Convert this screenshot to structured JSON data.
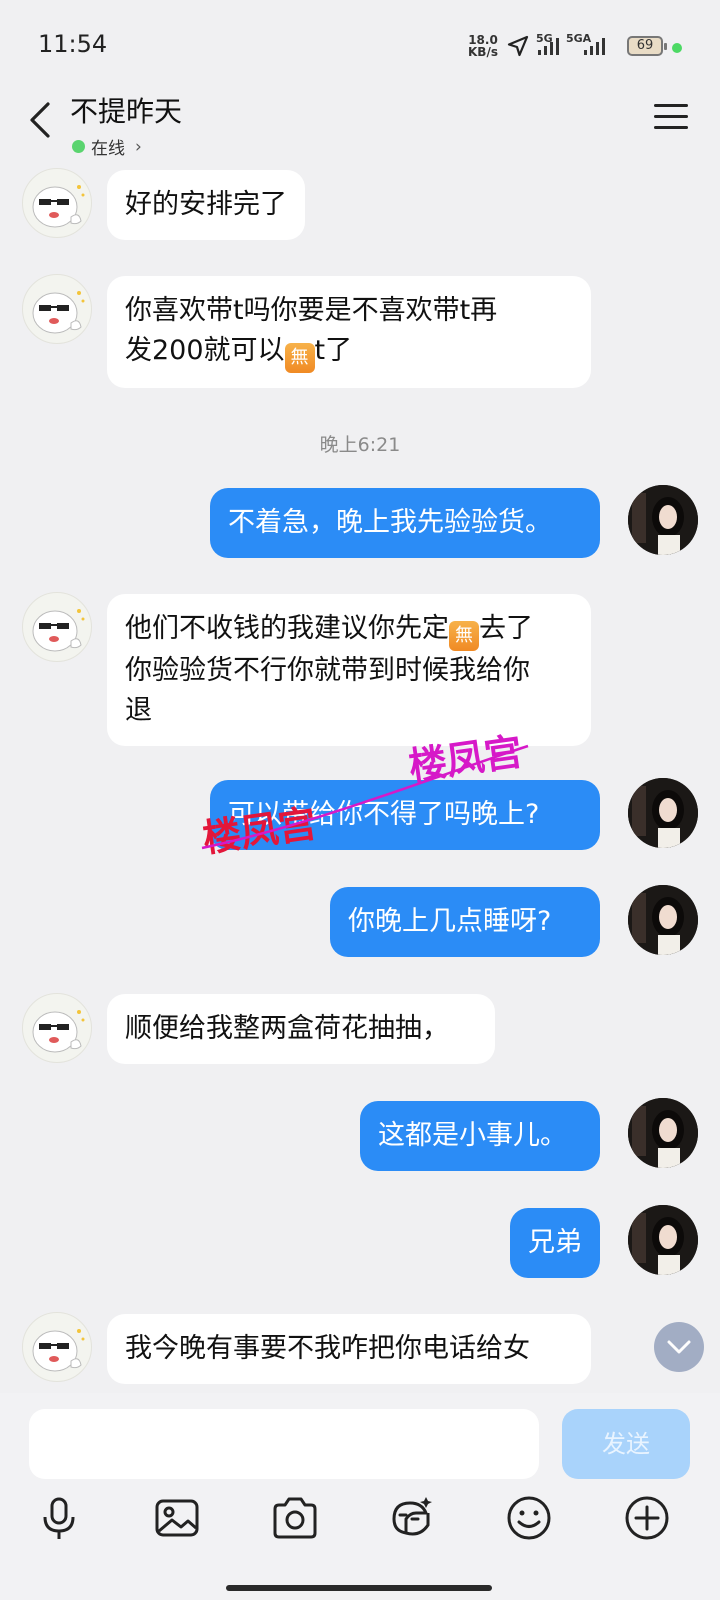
{
  "status_bar": {
    "time": "11:54",
    "net_speed_value": "18.0",
    "net_speed_unit": "KB/s",
    "sim1": "5G",
    "sim2": "5GA",
    "battery": "69"
  },
  "header": {
    "title": "不提昨天",
    "status": "在线",
    "status_chevron": "›"
  },
  "messages": [
    {
      "from": "other",
      "text": "好的安排完了"
    },
    {
      "from": "other",
      "text_part1": "你喜欢带t吗你要是不喜欢带t再\n发200就可以",
      "emoji": "無",
      "text_part2": "t了"
    },
    {
      "from": "time",
      "text": "晚上6:21"
    },
    {
      "from": "me",
      "text": "不着急，晚上我先验验货。"
    },
    {
      "from": "other",
      "text_part1": "他们不收钱的我建议你先定",
      "emoji": "無",
      "text_part2": "去了\n你验验货不行你就带到时候我给你\n退"
    },
    {
      "from": "me",
      "text": "可以带给你不得了吗晚上?"
    },
    {
      "from": "me",
      "text": "你晚上几点睡呀?"
    },
    {
      "from": "other",
      "text": "顺便给我整两盒荷花抽抽，"
    },
    {
      "from": "me",
      "text": "这都是小事儿。"
    },
    {
      "from": "me",
      "text": "兄弟"
    },
    {
      "from": "other",
      "text": "我今晚有事要不我咋把你电话给女"
    }
  ],
  "watermark": "楼凤宫",
  "input": {
    "value": "",
    "send_label": "发送"
  },
  "toolbar": [
    "mic-icon",
    "image-icon",
    "camera-icon",
    "sticker-icon",
    "emoji-icon",
    "plus-icon"
  ],
  "colors": {
    "accent": "#2b8cf6",
    "background": "#f0f0f2",
    "online": "#5ad46f",
    "send_disabled": "#a9d3fb"
  }
}
